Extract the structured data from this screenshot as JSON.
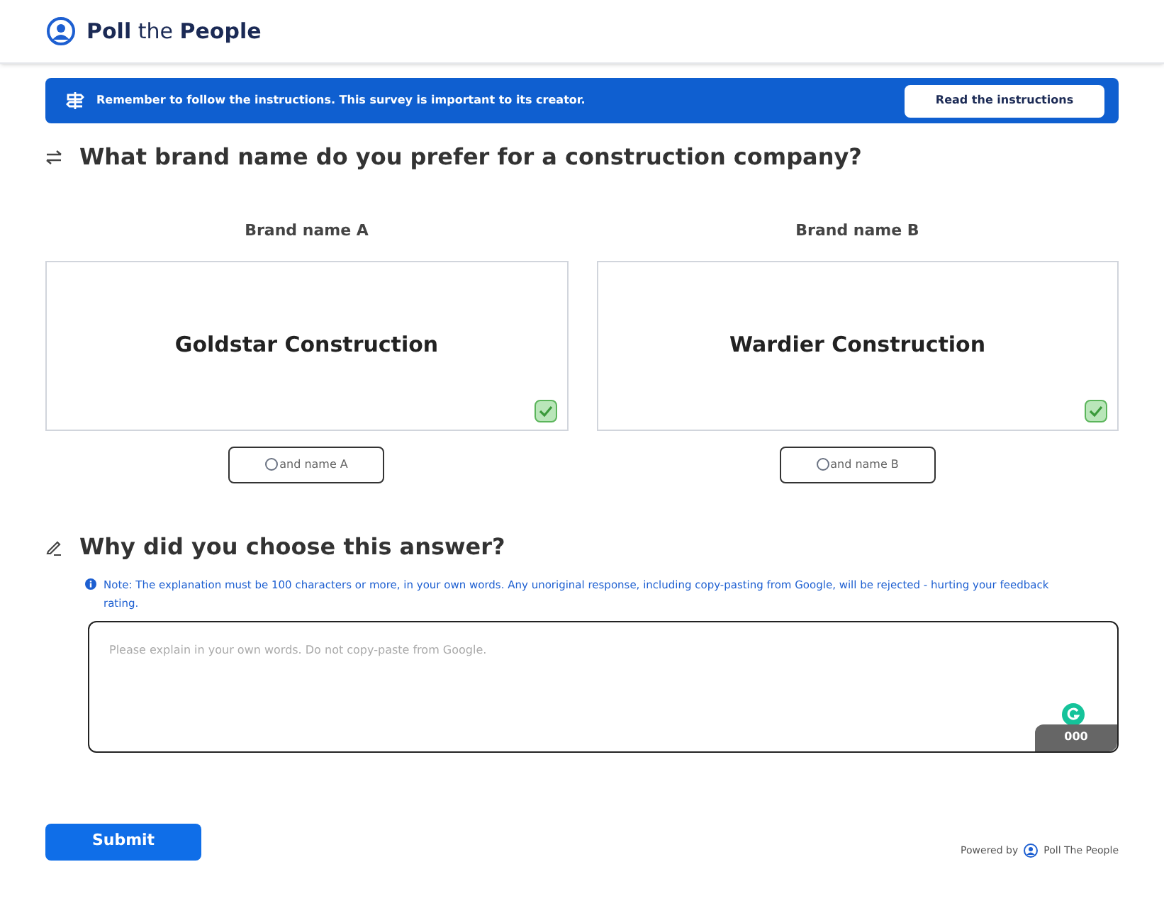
{
  "header": {
    "logo_text": "**Poll** the **People**"
  },
  "banner": {
    "message": "Remember to follow the instructions. This survey is important to its creator.",
    "button": "Read the instructions"
  },
  "question": {
    "title": "What brand name do you prefer for a construction company?"
  },
  "options": [
    {
      "heading": "Brand name A",
      "name": "Goldstar Construction",
      "checked": true,
      "radio_label": "and name A",
      "selected": false
    },
    {
      "heading": "Brand name B",
      "name": "Wardier Construction",
      "checked": true,
      "radio_label": "and name B",
      "selected": false
    }
  ],
  "explanation": {
    "title": "Why did you choose this answer?",
    "note": "Note: The explanation must be 100 characters or more, in your own words. Any unoriginal response, including copy-pasting from Google, will be rejected - hurting your feedback rating.",
    "placeholder": "Please explain in your own words. Do not copy-paste from Google.",
    "counter": "000"
  },
  "submit": "Submit",
  "footer": {
    "powered_by": "Powered by",
    "brand": "Poll The People"
  }
}
